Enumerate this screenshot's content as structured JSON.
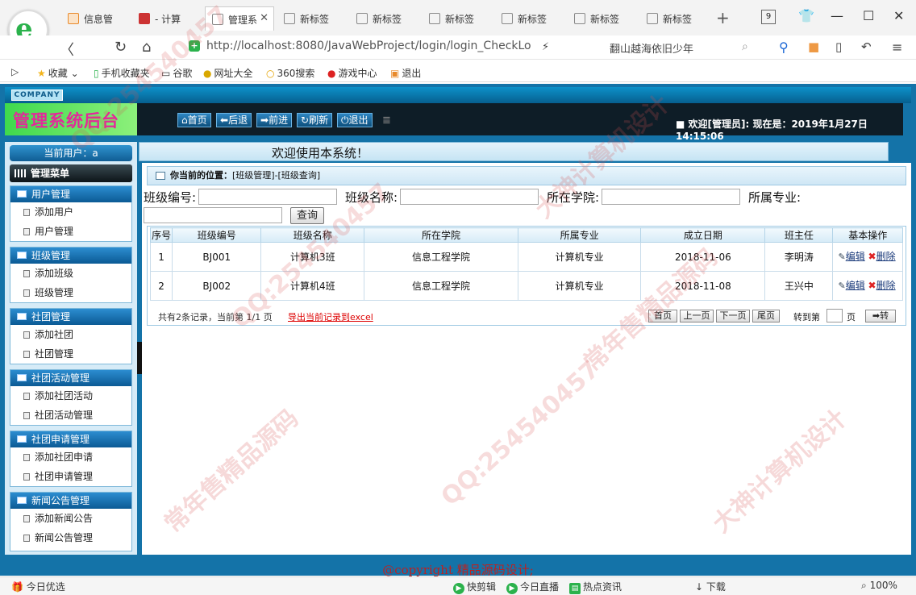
{
  "browser": {
    "tabs": [
      {
        "label": "信息管"
      },
      {
        "label": "- 计算"
      },
      {
        "label": "管理系"
      },
      {
        "label": "新标签"
      },
      {
        "label": "新标签"
      },
      {
        "label": "新标签"
      },
      {
        "label": "新标签"
      },
      {
        "label": "新标签"
      },
      {
        "label": "新标签"
      }
    ],
    "tab_count": "9",
    "url": "http://localhost:8080/JavaWebProject/login/login_CheckLo",
    "search_text": "翻山越海依旧少年",
    "bookmarks": [
      "收藏",
      "手机收藏夹",
      "谷歌",
      "网址大全",
      "360搜索",
      "游戏中心",
      "退出"
    ]
  },
  "app": {
    "company": "COMPANY",
    "brand": "管理系统后台",
    "nav_buttons": [
      "首页",
      "后退",
      "前进",
      "刷新",
      "退出"
    ],
    "welcome": "■ 欢迎[管理员]:  现在是：2019年1月27日 14:15:06",
    "welcome_banner": "欢迎使用本系统！",
    "current_user": "当前用户：a",
    "menu_title": "管理菜单",
    "menu_groups": [
      {
        "title": "用户管理",
        "items": [
          "添加用户",
          "用户管理"
        ]
      },
      {
        "title": "班级管理",
        "items": [
          "添加班级",
          "班级管理"
        ]
      },
      {
        "title": "社团管理",
        "items": [
          "添加社团",
          "社团管理"
        ]
      },
      {
        "title": "社团活动管理",
        "items": [
          "添加社团活动",
          "社团活动管理"
        ]
      },
      {
        "title": "社团申请管理",
        "items": [
          "添加社团申请",
          "社团申请管理"
        ]
      },
      {
        "title": "新闻公告管理",
        "items": [
          "添加新闻公告",
          "新闻公告管理"
        ]
      }
    ]
  },
  "main": {
    "location_label": "你当前的位置：",
    "location_path": "[班级管理]-[班级查询]",
    "filters": {
      "class_no_label": "班级编号:",
      "class_name_label": "班级名称:",
      "college_label": "所在学院:",
      "major_label": "所属专业:",
      "query_button": "查询"
    },
    "table": {
      "headers": [
        "序号",
        "班级编号",
        "班级名称",
        "所在学院",
        "所属专业",
        "成立日期",
        "班主任",
        "基本操作"
      ],
      "rows": [
        [
          "1",
          "BJ001",
          "计算机3班",
          "信息工程学院",
          "计算机专业",
          "2018-11-06",
          "李明涛"
        ],
        [
          "2",
          "BJ002",
          "计算机4班",
          "信息工程学院",
          "计算机专业",
          "2018-11-08",
          "王兴中"
        ]
      ],
      "edit_label": "编辑",
      "delete_label": "删除"
    },
    "pager": {
      "summary": "共有2条记录，当前第 1/1 页",
      "export": "导出当前记录到excel",
      "first": "首页",
      "prev": "上一页",
      "next": "下一页",
      "last": "尾页",
      "goto_label": "转到第",
      "page_label": "页",
      "go": "➡转"
    },
    "copyright": "@copyright 精品源码设计;"
  },
  "statusbar": {
    "left": "今日优选",
    "items": [
      "快剪辑",
      "今日直播",
      "热点资讯",
      "下载"
    ],
    "zoom": "100%"
  },
  "watermarks": [
    "QQ:254540457",
    "常年售精品源码",
    "大神计算机设计"
  ]
}
